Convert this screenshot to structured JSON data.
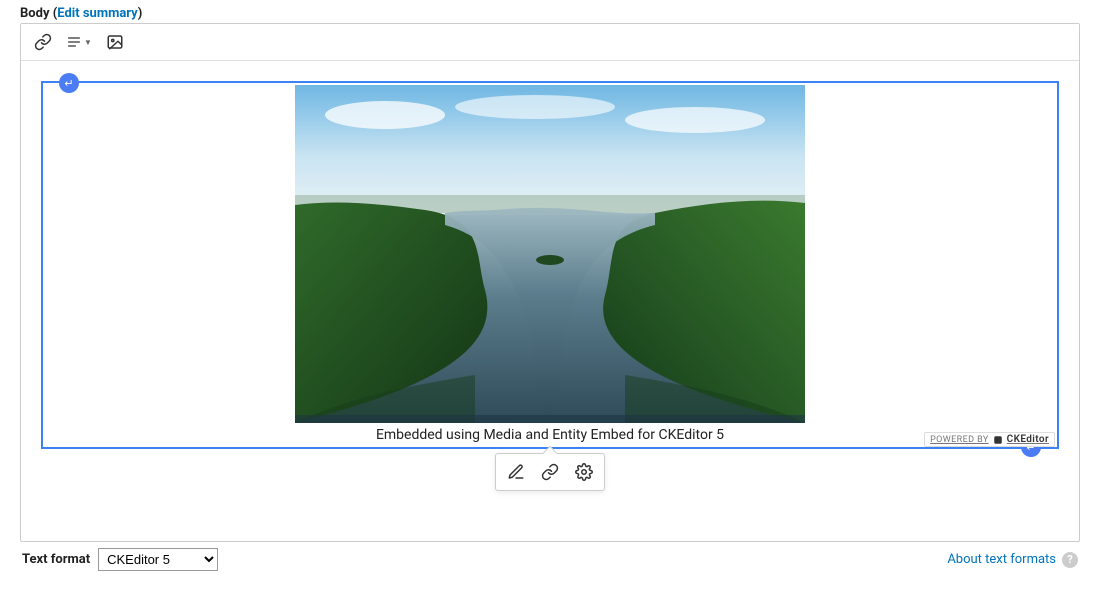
{
  "field": {
    "label": "Body",
    "edit_summary_link": "Edit summary",
    "paren_open": " (",
    "paren_close": ")"
  },
  "toolbar": {
    "link_tooltip": "Link",
    "list_tooltip": "Bulleted List",
    "image_tooltip": "Insert image"
  },
  "embed": {
    "caption": "Embedded using Media and Entity Embed for CKEditor 5",
    "balloon": {
      "edit_tooltip": "Edit",
      "link_tooltip": "Link",
      "override_tooltip": "Override"
    }
  },
  "powered_by": {
    "prefix": "POWERED BY",
    "brand": "CKEditor"
  },
  "format": {
    "label": "Text format",
    "selected": "CKEditor 5",
    "about_link": "About text formats"
  }
}
